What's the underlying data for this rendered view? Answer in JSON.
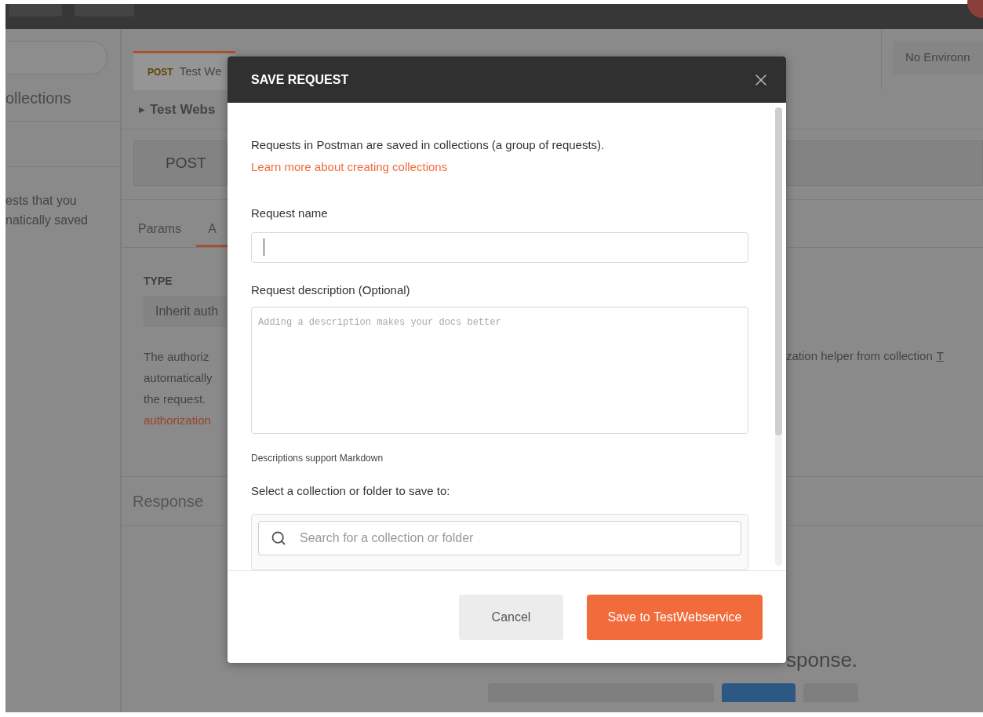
{
  "sidebar": {
    "heading": "ollections",
    "empty_lines": [
      "ests that you",
      "natically saved"
    ]
  },
  "request_tab": {
    "method": "POST",
    "name": "Test We",
    "selected": true
  },
  "environment": "No Environn",
  "breadcrumb_icon": "▶",
  "breadcrumb": "Test Webs",
  "method_select": "POST",
  "subtabs": [
    {
      "label": "Params",
      "selected": false
    },
    {
      "label": "A",
      "selected": true
    }
  ],
  "auth": {
    "type_label": "TYPE",
    "type_value": "Inherit auth",
    "lines": [
      "The authoriz",
      "automatically",
      "the request."
    ],
    "link": "authorization",
    "right_text": "zation helper from collection",
    "right_link": "T"
  },
  "response": {
    "title": "Response",
    "hint": "sponse."
  },
  "dialog": {
    "title": "SAVE REQUEST",
    "intro": "Requests in Postman are saved in collections (a group of requests).",
    "learn_link": "Learn more about creating collections",
    "name_label": "Request name",
    "name_focused": true,
    "description_label": "Request description (Optional)",
    "description_placeholder": "Adding a description makes your docs better",
    "markdown_note": "Descriptions support Markdown",
    "collection_label": "Select a collection or folder to save to:",
    "collection_search_placeholder": "Search for a collection or folder",
    "buttons": [
      {
        "label": "Cancel",
        "kind": "secondary"
      },
      {
        "label": "Save to TestWebservice",
        "kind": "primary"
      }
    ]
  }
}
